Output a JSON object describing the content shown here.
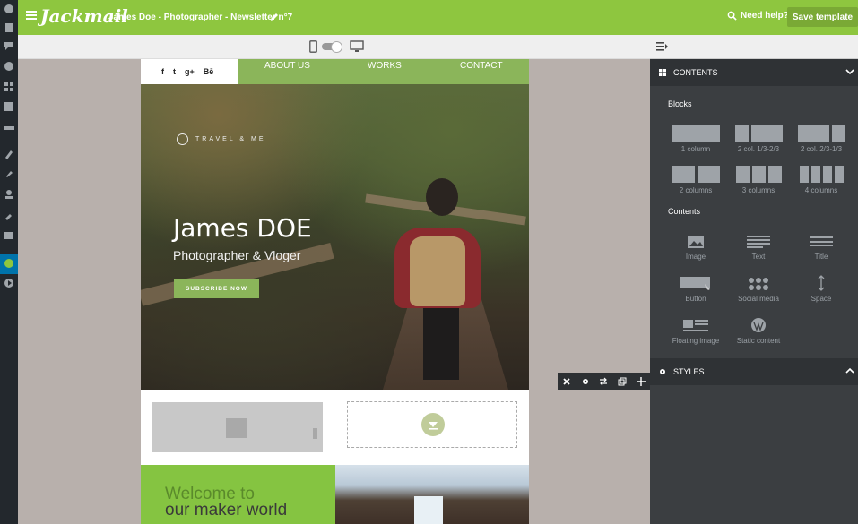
{
  "app": {
    "logo": "Jackmail",
    "doc_title": "James Doe - Photographer - Newsletter n°7",
    "help": "Need help?",
    "save": "Save template"
  },
  "email": {
    "social": [
      "f",
      "t",
      "g+",
      "Bē"
    ],
    "nav": [
      "ABOUT US",
      "WORKS",
      "CONTACT"
    ],
    "brand": "TRAVEL & ME",
    "hero_name": "James DOE",
    "hero_sub": "Photographer & Vloger",
    "subscribe": "SUBSCRIBE NOW",
    "welcome_1": "Welcome to",
    "welcome_2": "our maker world"
  },
  "panel": {
    "contents_head": "CONTENTS",
    "blocks_title": "Blocks",
    "blocks": [
      "1 column",
      "2 col. 1/3-2/3",
      "2 col. 2/3-1/3",
      "2 columns",
      "3 columns",
      "4 columns"
    ],
    "contents_title": "Contents",
    "contents": [
      "Image",
      "Text",
      "Title",
      "Button",
      "Social media",
      "Space",
      "Floating image",
      "Static content"
    ],
    "styles_head": "STYLES"
  },
  "colors": {
    "brand_green": "#8ec63f",
    "panel_dark": "#3b3e41"
  }
}
